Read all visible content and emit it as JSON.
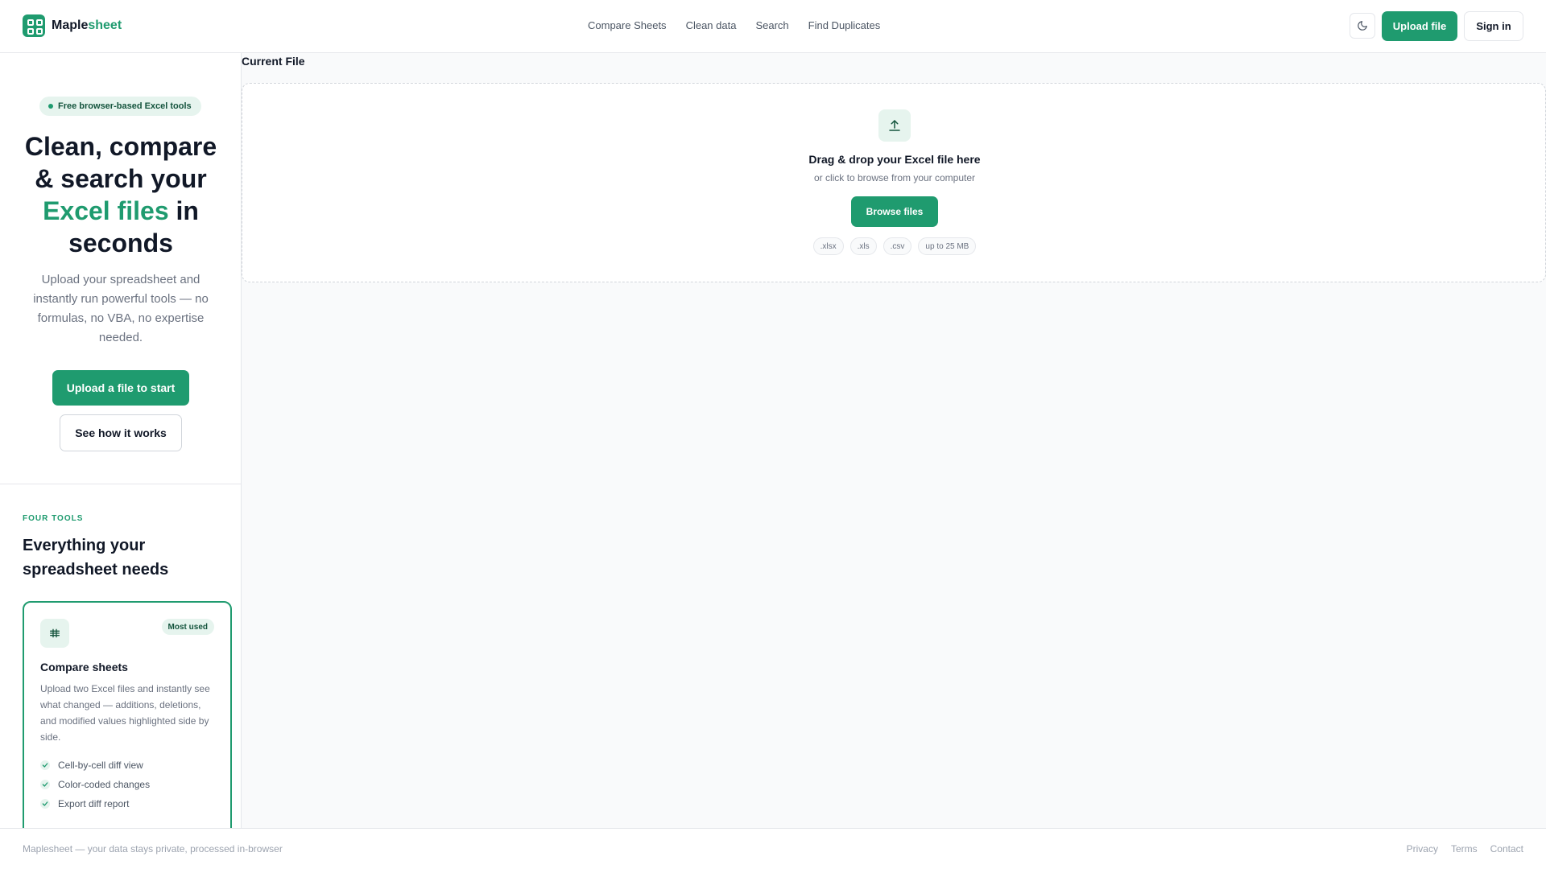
{
  "brand": {
    "name_part1": "Maple",
    "name_part2": "sheet",
    "accent_color": "#1f9b6f",
    "logo_icon": "grid-icon"
  },
  "nav": {
    "items": [
      {
        "label": "Compare Sheets"
      },
      {
        "label": "Clean data"
      },
      {
        "label": "Search"
      },
      {
        "label": "Find Duplicates"
      }
    ]
  },
  "header_actions": {
    "theme_icon": "moon-icon",
    "upload_label": "Upload file",
    "signin_label": "Sign in"
  },
  "hero": {
    "pill": "Free browser-based Excel tools",
    "title_part1": "Clean, compare & search your",
    "title_accent": "Excel files",
    "title_part2": "in seconds",
    "description": "Upload your spreadsheet and instantly run powerful tools — no formulas, no VBA, no expertise needed.",
    "primary_cta": "Upload a file to start",
    "secondary_cta": "See how it works"
  },
  "tools": {
    "eyebrow": "FOUR TOOLS",
    "heading": "Everything your spreadsheet needs",
    "cards": [
      {
        "icon": "compare-icon",
        "badge": "Most used",
        "title": "Compare sheets",
        "description": "Upload two Excel files and instantly see what changed — additions, deletions, and modified values highlighted side by side.",
        "features": [
          "Cell-by-cell diff view",
          "Color-coded changes",
          "Export diff report"
        ]
      }
    ]
  },
  "main": {
    "current_file_label": "Current File",
    "dropzone": {
      "icon": "upload-icon",
      "title": "Drag & drop your Excel file here",
      "subtitle": "or click to browse from your computer",
      "browse_label": "Browse files",
      "chips": [
        ".xlsx",
        ".xls",
        ".csv",
        "up to 25 MB"
      ]
    }
  },
  "footer": {
    "note": "Maplesheet — your data stays private, processed in-browser",
    "links": [
      "Privacy",
      "Terms",
      "Contact"
    ]
  }
}
